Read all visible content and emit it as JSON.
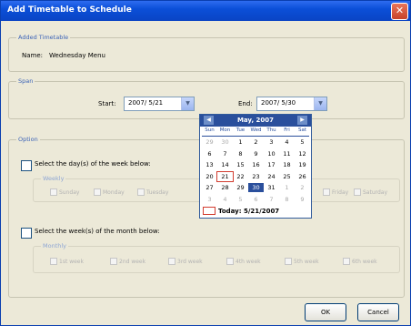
{
  "window": {
    "title": "Add Timetable to Schedule",
    "close_glyph": "✕"
  },
  "added_timetable": {
    "group_label": "Added Timetable",
    "name_label": "Name:",
    "name_value": "Wednesday Menu"
  },
  "span": {
    "group_label": "Span",
    "start_label": "Start:",
    "start_value": "2007/ 5/21",
    "end_label": "End:",
    "end_value": "2007/ 5/30",
    "dropdown_glyph": "▼"
  },
  "calendar": {
    "month_label": "May, 2007",
    "prev_glyph": "◀",
    "next_glyph": "▶",
    "weekdays": [
      "Sun",
      "Mon",
      "Tue",
      "Wed",
      "Thu",
      "Fri",
      "Sat"
    ],
    "weeks": [
      [
        {
          "d": "29",
          "o": true
        },
        {
          "d": "30",
          "o": true
        },
        {
          "d": "1"
        },
        {
          "d": "2"
        },
        {
          "d": "3"
        },
        {
          "d": "4"
        },
        {
          "d": "5"
        }
      ],
      [
        {
          "d": "6"
        },
        {
          "d": "7"
        },
        {
          "d": "8"
        },
        {
          "d": "9"
        },
        {
          "d": "10"
        },
        {
          "d": "11"
        },
        {
          "d": "12"
        }
      ],
      [
        {
          "d": "13"
        },
        {
          "d": "14"
        },
        {
          "d": "15"
        },
        {
          "d": "16"
        },
        {
          "d": "17"
        },
        {
          "d": "18"
        },
        {
          "d": "19"
        }
      ],
      [
        {
          "d": "20"
        },
        {
          "d": "21",
          "today": true
        },
        {
          "d": "22"
        },
        {
          "d": "23"
        },
        {
          "d": "24"
        },
        {
          "d": "25"
        },
        {
          "d": "26"
        }
      ],
      [
        {
          "d": "27"
        },
        {
          "d": "28"
        },
        {
          "d": "29"
        },
        {
          "d": "30",
          "sel": true
        },
        {
          "d": "31"
        },
        {
          "d": "1",
          "o": true
        },
        {
          "d": "2",
          "o": true
        }
      ],
      [
        {
          "d": "3",
          "o": true
        },
        {
          "d": "4",
          "o": true
        },
        {
          "d": "5",
          "o": true
        },
        {
          "d": "6",
          "o": true
        },
        {
          "d": "7",
          "o": true
        },
        {
          "d": "8",
          "o": true
        },
        {
          "d": "9",
          "o": true
        }
      ]
    ],
    "today_label": "Today: 5/21/2007"
  },
  "option": {
    "group_label": "Option",
    "days_checkbox_label": "Select the day(s) of the week below:",
    "weekly_label": "Weekly",
    "weekly_days": [
      "Sunday",
      "Monday",
      "Tuesday",
      "Friday",
      "Saturday"
    ],
    "weeks_checkbox_label": "Select the week(s) of the month below:",
    "monthly_label": "Monthly",
    "monthly_weeks": [
      "1st week",
      "2nd week",
      "3rd week",
      "4th week",
      "5th week",
      "6th week"
    ]
  },
  "buttons": {
    "ok": "OK",
    "cancel": "Cancel"
  }
}
